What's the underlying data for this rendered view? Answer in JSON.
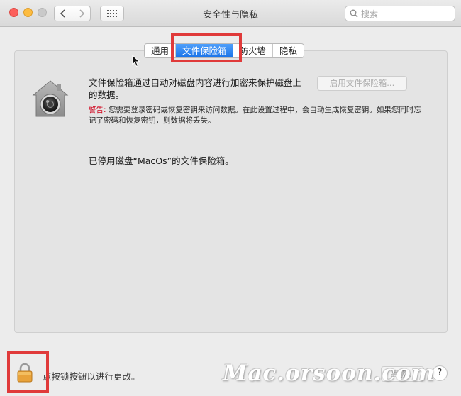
{
  "window": {
    "title": "安全性与隐私"
  },
  "search": {
    "placeholder": "搜索",
    "icon": "search-icon"
  },
  "tabs": [
    {
      "label": "通用",
      "active": false
    },
    {
      "label": "文件保险箱",
      "active": true
    },
    {
      "label": "防火墙",
      "active": false
    },
    {
      "label": "隐私",
      "active": false
    }
  ],
  "filevault": {
    "description": "文件保险箱通过自动对磁盘内容进行加密来保护磁盘上的数据。",
    "enable_button": "启用文件保险箱...",
    "warning_label": "警告:",
    "warning_text": " 您需要登录密码或恢复密钥来访问数据。在此设置过程中，会自动生成恢复密钥。如果您同时忘记了密码和恢复密钥，则数据将丢失。",
    "status": "已停用磁盘“MacOs”的文件保险箱。"
  },
  "footer": {
    "lock_text": "点按锁按钮以进行更改。",
    "advanced_button": "高级...",
    "help_button": "?"
  },
  "watermark": "Mac.orsoon.com",
  "colors": {
    "accent": "#1a73e8",
    "warning": "#d0021b",
    "highlight": "#e03a3a",
    "lock": "#e8a23a"
  }
}
